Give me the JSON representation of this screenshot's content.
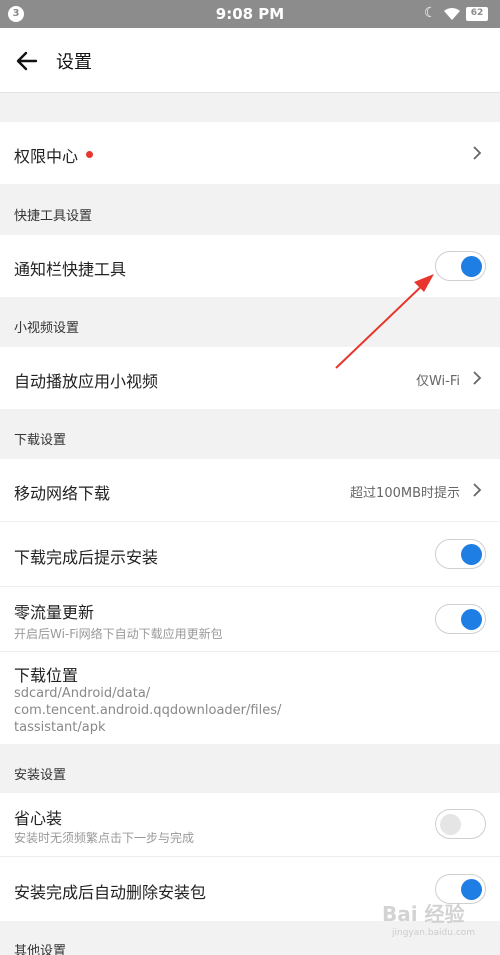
{
  "status_bar": {
    "badge": "3",
    "time": "9:08 PM",
    "battery": "62"
  },
  "header": {
    "title": "设置"
  },
  "permissions": {
    "label": "权限中心"
  },
  "sections": {
    "quick_tools": "快捷工具设置",
    "short_video": "小视频设置",
    "download": "下载设置",
    "install": "安装设置",
    "other": "其他设置"
  },
  "rows": {
    "notification_tools": {
      "label": "通知栏快捷工具",
      "on": true
    },
    "autoplay_video": {
      "label": "自动播放应用小视频",
      "value": "仅Wi-Fi"
    },
    "mobile_download": {
      "label": "移动网络下载",
      "value": "超过100MB时提示"
    },
    "prompt_install": {
      "label": "下载完成后提示安装",
      "on": true
    },
    "zero_traffic": {
      "label": "零流量更新",
      "sub": "开启后Wi-Fi网络下自动下载应用更新包",
      "on": true
    },
    "download_location": {
      "label": "下载位置",
      "path_line1": "sdcard/Android/data/",
      "path_line2": "com.tencent.android.qqdownloader/files/",
      "path_line3": "tassistant/apk"
    },
    "easy_install": {
      "label": "省心装",
      "sub": "安装时无须频繁点击下一步与完成",
      "on": false
    },
    "auto_delete": {
      "label": "安装完成后自动删除安装包",
      "on": true
    }
  },
  "watermark": {
    "text": "Bai 经验",
    "sub": "jingyan.baidu.com"
  },
  "colors": {
    "toggle_on": "#1e7ee3",
    "annotation_arrow": "#e8362c",
    "status_bar": "#8c8c8c"
  }
}
